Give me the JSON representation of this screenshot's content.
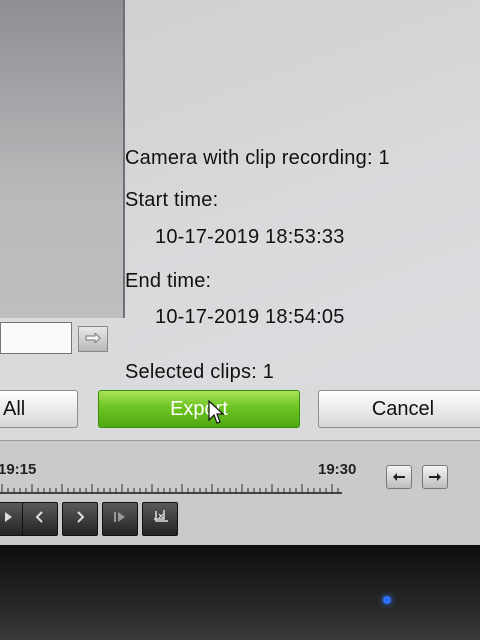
{
  "clip_info": {
    "camera_line": "Camera with clip recording: 1",
    "start_label": "Start time:",
    "start_value": "10-17-2019 18:53:33",
    "end_label": "End time:",
    "end_value": "10-17-2019 18:54:05",
    "selected_line": "Selected clips: 1"
  },
  "actions": {
    "all_label": "All",
    "export_label": "Export",
    "cancel_label": "Cancel"
  },
  "timeline": {
    "left_time": "19:15",
    "right_time": "19:30"
  },
  "icons": {
    "path_button": "right-arrow-icon",
    "prev_button": "left-arrow-icon",
    "next_button": "right-arrow-icon",
    "playback": [
      "play-icon",
      "prev-icon",
      "next-icon",
      "step-icon",
      "clip-icon"
    ]
  },
  "colors": {
    "export_green": "#6dc521",
    "power_led": "#2b6fff"
  }
}
